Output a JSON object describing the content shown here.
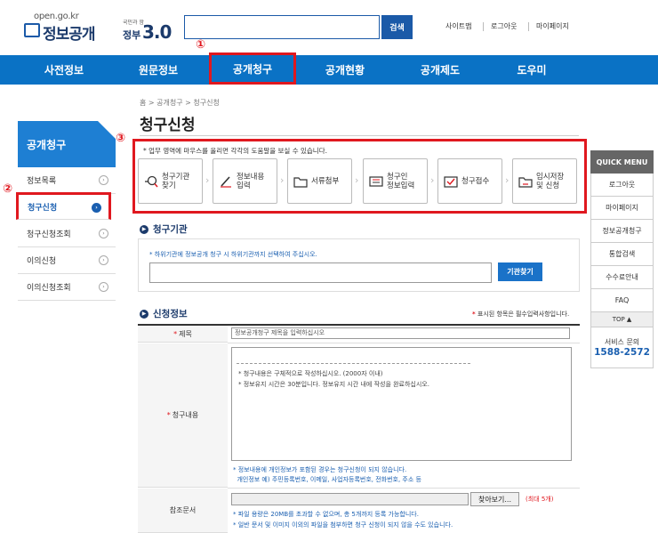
{
  "header": {
    "logo_url": "open.go.kr",
    "logo_name": "정보공개",
    "gov_small": "국민과 함께하는",
    "gov_main": "정부",
    "gov_num": "3.0",
    "search_placeholder": "",
    "search_button": "검색",
    "util_links": [
      "사이트맵",
      "로그아웃",
      "마이페이지"
    ]
  },
  "nav": {
    "items": [
      "사전정보",
      "원문정보",
      "공개청구",
      "공개현황",
      "공개제도",
      "도우미"
    ]
  },
  "markers": {
    "m1": "①",
    "m2": "②",
    "m3": "③"
  },
  "breadcrumb": "홈 > 공개청구 > 청구신청",
  "page_title": "청구신청",
  "sidebar": {
    "title": "공개청구",
    "items": [
      {
        "label": "정보목록"
      },
      {
        "label": "청구신청"
      },
      {
        "label": "청구신청조회"
      },
      {
        "label": "이의신청"
      },
      {
        "label": "이의신청조회"
      }
    ],
    "arrow": "›"
  },
  "steps": {
    "guide": "* 업무 영역에 마우스를 올리면 각각의 도움말을 보실 수 있습니다.",
    "items": [
      {
        "label": "청구기관\n찾기",
        "icon": "search-icon"
      },
      {
        "label": "정보내용\n입력",
        "icon": "pencil-icon"
      },
      {
        "label": "서류첨부",
        "icon": "folder-icon"
      },
      {
        "label": "청구인\n정보입력",
        "icon": "id-card-icon"
      },
      {
        "label": "청구접수",
        "icon": "checklist-icon"
      },
      {
        "label": "임시저장\n및 신청",
        "icon": "save-folder-icon"
      }
    ],
    "chevron": "›"
  },
  "institution": {
    "title": "청구기관",
    "note": "* 하위기관에 정보공개 청구 시 하위기관까지 선택하여 주십시오.",
    "button": "기관찾기"
  },
  "application": {
    "title": "신청정보",
    "required_note_star": "*",
    "required_note": " 표시된 항목은 필수입력사항입니다.",
    "subject_label": "제목",
    "subject_value": "정보공개청구 제목을 입력하십시오",
    "content_label": "청구내용",
    "content_lines": [
      "* 청구내용은 구체적으로 작성하십시오. (2000자 이내)",
      "* 정보유지 시간은 30분입니다. 정보유지 시간 내에 작성을 완료하십시오."
    ],
    "content_notes": [
      "* 정보내용에 개인정보가 포함된 경우는 청구신청이 되지 않습니다.",
      "  개인정보 예) 주민등록번호, 이메일, 사업자등록번호, 전화번호, 주소 등"
    ],
    "ref_label": "참조문서",
    "file_button": "찾아보기...",
    "file_max": "(최대 5개)",
    "file_notes": [
      "* 파일 용량은 20MB를 초과할 수 없으며, 총 5개까지 등록 가능합니다.",
      "* 일반 문서 및 이미지 이외의 파일을 첨부하면 청구 신청이 되지 않을 수도 있습니다."
    ],
    "star": "*"
  },
  "quick_menu": {
    "title": "QUICK MENU",
    "items": [
      "로그아웃",
      "마이페이지",
      "정보공개청구",
      "통합검색",
      "수수료안내",
      "FAQ"
    ],
    "top": "TOP ▲",
    "service_label": "서비스 문의",
    "service_phone": "1588-2572"
  },
  "colors": {
    "nav": "#0a72c5",
    "highlight": "#e0181f",
    "sidebar_head": "#1e7fd3",
    "accent": "#1a5fb0"
  }
}
